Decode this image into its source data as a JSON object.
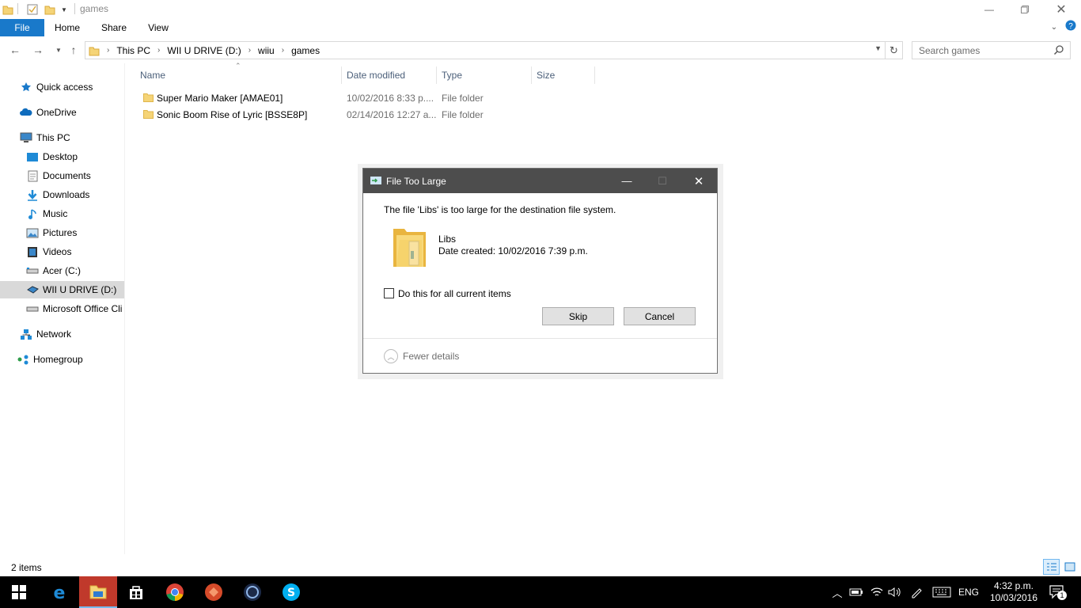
{
  "window": {
    "title": "games"
  },
  "ribbon": {
    "tabs": [
      "File",
      "Home",
      "Share",
      "View"
    ]
  },
  "address": {
    "crumbs": [
      "This PC",
      "WII U DRIVE (D:)",
      "wiiu",
      "games"
    ]
  },
  "search": {
    "placeholder": "Search games"
  },
  "navpane": {
    "items": [
      {
        "label": "Quick access",
        "icon": "star-icon",
        "color": "#1979ca"
      },
      {
        "label": "OneDrive",
        "icon": "cloud-icon",
        "color": "#0f6cbd"
      },
      {
        "label": "This PC",
        "icon": "computer-icon",
        "color": "#3a87c9"
      },
      {
        "label": "Desktop",
        "icon": "desktop-icon",
        "color": "#1e8ad6"
      },
      {
        "label": "Documents",
        "icon": "document-icon",
        "color": "#777777"
      },
      {
        "label": "Downloads",
        "icon": "download-icon",
        "color": "#1e8ad6"
      },
      {
        "label": "Music",
        "icon": "music-icon",
        "color": "#1e8ad6"
      },
      {
        "label": "Pictures",
        "icon": "pictures-icon",
        "color": "#3a87c9"
      },
      {
        "label": "Videos",
        "icon": "videos-icon",
        "color": "#333333"
      },
      {
        "label": "Acer (C:)",
        "icon": "drive-icon",
        "color": "#555555"
      },
      {
        "label": "WII U DRIVE (D:)",
        "icon": "usb-drive-icon",
        "color": "#3a87c9"
      },
      {
        "label": "Microsoft Office Cli",
        "icon": "drive-icon",
        "color": "#555555"
      },
      {
        "label": "Network",
        "icon": "network-icon",
        "color": "#1e8ad6"
      },
      {
        "label": "Homegroup",
        "icon": "homegroup-icon",
        "color": "#2e9c4a"
      }
    ]
  },
  "columns": [
    "Name",
    "Date modified",
    "Type",
    "Size"
  ],
  "files": [
    {
      "name": "Super Mario Maker [AMAE01]",
      "date": "10/02/2016 8:33 p....",
      "type": "File folder"
    },
    {
      "name": "Sonic Boom Rise of Lyric [BSSE8P]",
      "date": "02/14/2016 12:27 a...",
      "type": "File folder"
    }
  ],
  "status": {
    "items": "2 items"
  },
  "dialog": {
    "title": "File Too Large",
    "message": "The file 'Libs' is too large for the destination file system.",
    "file_name": "Libs",
    "file_date": "Date created: 10/02/2016 7:39 p.m.",
    "checkbox_label": "Do this for all current items",
    "skip_label": "Skip",
    "cancel_label": "Cancel",
    "details_label": "Fewer details"
  },
  "taskbar": {
    "lang": "ENG",
    "time": "4:32 p.m.",
    "date": "10/03/2016",
    "notifications": "1"
  },
  "colors": {
    "accent": "#1979ca",
    "dialog_title": "#4d4d4d",
    "taskbar": "#000000"
  }
}
